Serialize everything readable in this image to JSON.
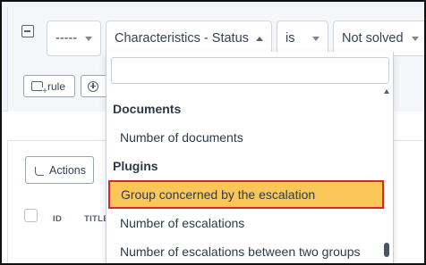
{
  "criteria": {
    "field_select": "-----",
    "criteria_select": "Characteristics - Status",
    "operator_select": "is",
    "value_select": "Not solved",
    "rule_button": "rule"
  },
  "dropdown": {
    "search_value": "",
    "groups": [
      {
        "label": "Documents",
        "options": [
          "Number of documents"
        ]
      },
      {
        "label": "Plugins",
        "options": [
          "Group concerned by the escalation",
          "Number of escalations",
          "Number of escalations between two groups"
        ]
      }
    ],
    "highlighted": "Group concerned by the escalation"
  },
  "results": {
    "actions_button": "Actions",
    "columns": [
      "ID",
      "TITLE"
    ]
  },
  "colors": {
    "highlight": "#fbc659",
    "highlight_border": "#d9262b"
  }
}
